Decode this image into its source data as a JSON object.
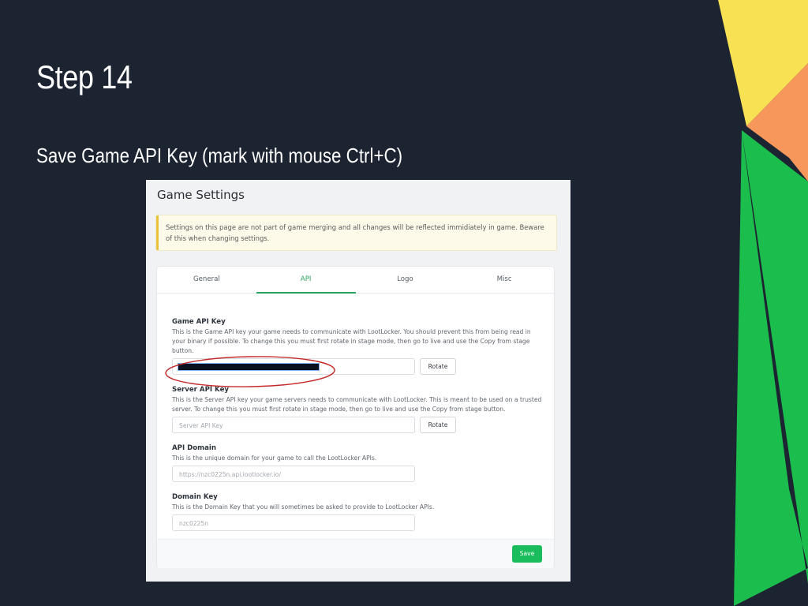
{
  "slide": {
    "title": "Step 14",
    "subtitle": "Save Game API Key (mark with mouse Ctrl+C)"
  },
  "colors": {
    "background": "#1c2331",
    "deco_yellow": "#f9e154",
    "deco_orange": "#f7975b",
    "deco_green": "#1bbd4d",
    "accent_green": "#2aa160",
    "save_button": "#19bd5b",
    "annotation_red": "#c62b2b"
  },
  "game_settings": {
    "title": "Game Settings",
    "notice": "Settings on this page are not part of game merging and all changes will be reflected immidiately in game. Beware of this when changing settings.",
    "tabs": [
      {
        "label": "General",
        "active": false
      },
      {
        "label": "API",
        "active": true
      },
      {
        "label": "Logo",
        "active": false
      },
      {
        "label": "Misc",
        "active": false
      }
    ],
    "game_api_key": {
      "label": "Game API Key",
      "description": "This is the Game API key your game needs to communicate with LootLocker. You should prevent this from being read in your binary if possible. To change this you must first rotate in stage mode, then go to live and use the Copy from stage button.",
      "rotate_label": "Rotate"
    },
    "server_api_key": {
      "label": "Server API Key",
      "description": "This is the Server API key your game servers needs to communicate with LootLocker. This is meant to be used on a trusted server. To change this you must first rotate in stage mode, then go to live and use the Copy from stage button.",
      "placeholder": "Server API Key",
      "rotate_label": "Rotate"
    },
    "api_domain": {
      "label": "API Domain",
      "description": "This is the unique domain for your game to call the LootLocker APIs.",
      "value": "https://nzc0225n.api.lootlocker.io/"
    },
    "domain_key": {
      "label": "Domain Key",
      "description": "This is the Domain Key that you will sometimes be asked to provide to LootLocker APIs.",
      "value": "nzc0225n"
    },
    "save_label": "Save"
  }
}
